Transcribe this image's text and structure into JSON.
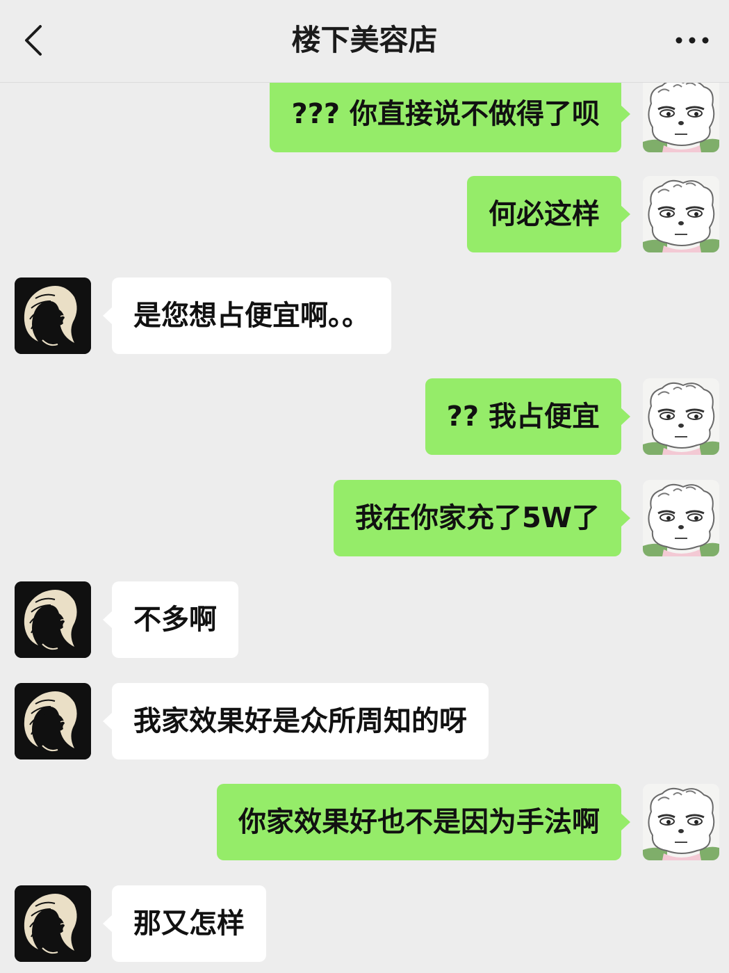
{
  "header": {
    "title": "楼下美容店",
    "back_icon": "chevron-left-icon",
    "more_icon": "more-dots-icon"
  },
  "colors": {
    "background": "#ededed",
    "sent_bubble": "#95ec69",
    "received_bubble": "#ffffff"
  },
  "messages": [
    {
      "side": "right",
      "text": "??? 你直接说不做得了呗"
    },
    {
      "side": "right",
      "text": "何必这样"
    },
    {
      "side": "left",
      "text": "是您想占便宜啊。。"
    },
    {
      "side": "right",
      "text": "?? 我占便宜"
    },
    {
      "side": "right",
      "text": "我在你家充了5W了"
    },
    {
      "side": "left",
      "text": "不多啊"
    },
    {
      "side": "left",
      "text": "我家效果好是众所周知的呀"
    },
    {
      "side": "right",
      "text": "你家效果好也不是因为手法啊"
    },
    {
      "side": "left",
      "text": "那又怎样"
    }
  ]
}
